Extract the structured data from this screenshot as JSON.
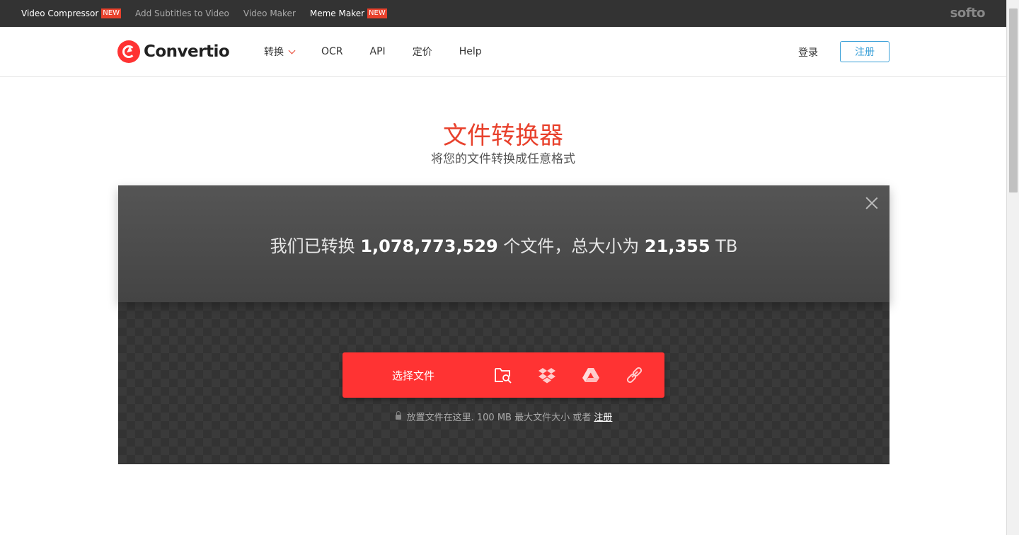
{
  "topbar": {
    "links": [
      {
        "label": "Video Compressor",
        "badge": "NEW"
      },
      {
        "label": "Add Subtitles to Video"
      },
      {
        "label": "Video Maker"
      },
      {
        "label": "Meme Maker",
        "badge": "NEW"
      }
    ],
    "brand": "softo"
  },
  "header": {
    "logo_text": "Convertio",
    "nav": [
      "转换",
      "OCR",
      "API",
      "定价",
      "Help"
    ],
    "login": "登录",
    "register": "注册"
  },
  "hero": {
    "title": "文件转换器",
    "subtitle": "将您的文件转换成任意格式"
  },
  "stats": {
    "prefix": "我们已转换 ",
    "files": "1,078,773,529",
    "middle": " 个文件，总大小为 ",
    "size": "21,355",
    "unit": " TB"
  },
  "upload": {
    "choose_label": "选择文件",
    "sources": [
      "folder-search-icon",
      "dropbox-icon",
      "google-drive-icon",
      "link-icon"
    ],
    "note_text": "放置文件在这里. 100 MB 最大文件大小 或者 ",
    "note_link": "注册"
  },
  "colors": {
    "accent": "#ff3333",
    "brand_red": "#e8412c",
    "link_blue": "#3aa0d8"
  }
}
